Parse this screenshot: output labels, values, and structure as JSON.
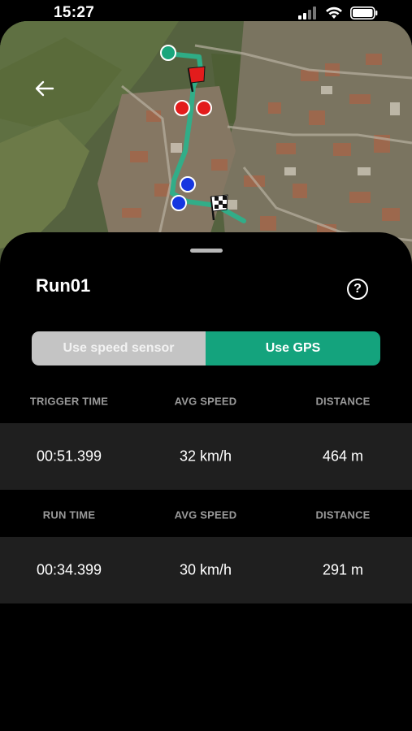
{
  "status_bar": {
    "time": "15:27"
  },
  "map": {
    "route_color": "#2db08a"
  },
  "sheet": {
    "title": "Run01",
    "help_label": "?",
    "toggle": {
      "speed_sensor_label": "Use speed sensor",
      "gps_label": "Use GPS",
      "selected": "Use GPS"
    },
    "trigger": {
      "headers": [
        "TRIGGER TIME",
        "AVG SPEED",
        "DISTANCE"
      ],
      "values": [
        "00:51.399",
        "32 km/h",
        "464 m"
      ]
    },
    "run": {
      "headers": [
        "RUN TIME",
        "AVG SPEED",
        "DISTANCE"
      ],
      "values": [
        "00:34.399",
        "30 km/h",
        "291 m"
      ]
    }
  },
  "colors": {
    "accent": "#14a37d",
    "inactive": "#c4c4c4",
    "row_bg": "#1f1f1f",
    "marker_red": "#e31c1c",
    "marker_blue": "#1636e0"
  },
  "icons": [
    "signal-icon",
    "wifi-icon",
    "battery-icon",
    "back-arrow-icon",
    "red-flag-icon",
    "checkered-flag-icon",
    "help-icon"
  ]
}
